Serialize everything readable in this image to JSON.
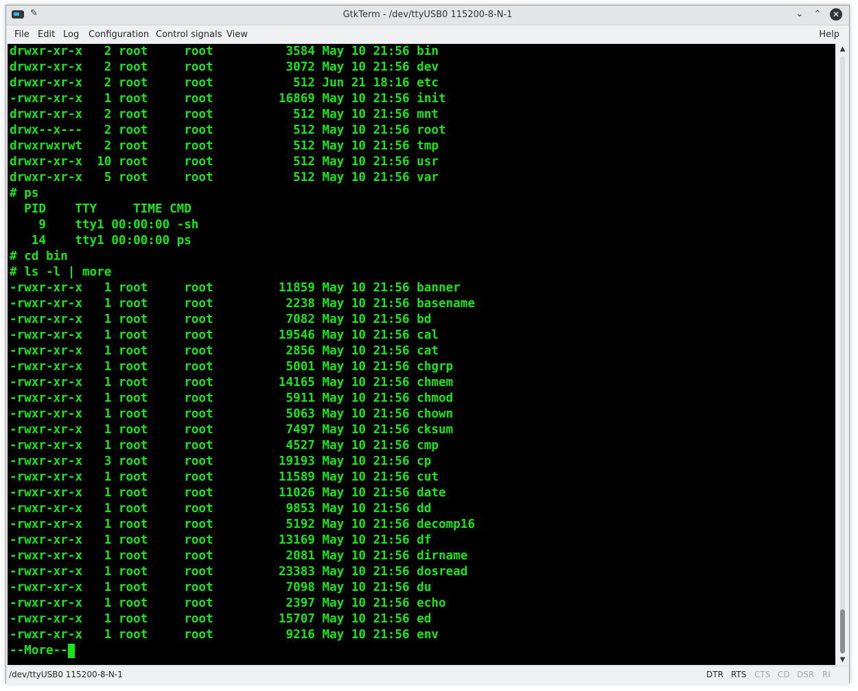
{
  "window": {
    "title": "GtkTerm - /dev/ttyUSB0 115200-8-N-1",
    "controls": {
      "minimize": "⌄",
      "maximize": "⌃",
      "close": "✕"
    },
    "icons": {
      "app": "terminal-app-icon",
      "pin": "pin-icon"
    }
  },
  "menubar": {
    "file": "File",
    "edit": "Edit",
    "log": "Log",
    "configuration": "Configuration",
    "control_signals": "Control signals",
    "view": "View",
    "help": "Help"
  },
  "terminal": {
    "text_color": "#19e619",
    "background": "#000000",
    "lines": [
      "drwxr-xr-x   2 root     root          3584 May 10 21:56 bin",
      "drwxr-xr-x   2 root     root          3072 May 10 21:56 dev",
      "drwxr-xr-x   2 root     root           512 Jun 21 18:16 etc",
      "-rwxr-xr-x   1 root     root         16869 May 10 21:56 init",
      "drwxr-xr-x   2 root     root           512 May 10 21:56 mnt",
      "drwx--x---   2 root     root           512 May 10 21:56 root",
      "drwxrwxrwt   2 root     root           512 May 10 21:56 tmp",
      "drwxr-xr-x  10 root     root           512 May 10 21:56 usr",
      "drwxr-xr-x   5 root     root           512 May 10 21:56 var",
      "# ps",
      "  PID    TTY     TIME CMD",
      "    9    tty1 00:00:00 -sh",
      "   14    tty1 00:00:00 ps",
      "# cd bin",
      "# ls -l | more",
      "-rwxr-xr-x   1 root     root         11859 May 10 21:56 banner",
      "-rwxr-xr-x   1 root     root          2238 May 10 21:56 basename",
      "-rwxr-xr-x   1 root     root          7082 May 10 21:56 bd",
      "-rwxr-xr-x   1 root     root         19546 May 10 21:56 cal",
      "-rwxr-xr-x   1 root     root          2856 May 10 21:56 cat",
      "-rwxr-xr-x   1 root     root          5001 May 10 21:56 chgrp",
      "-rwxr-xr-x   1 root     root         14165 May 10 21:56 chmem",
      "-rwxr-xr-x   1 root     root          5911 May 10 21:56 chmod",
      "-rwxr-xr-x   1 root     root          5063 May 10 21:56 chown",
      "-rwxr-xr-x   1 root     root          7497 May 10 21:56 cksum",
      "-rwxr-xr-x   1 root     root          4527 May 10 21:56 cmp",
      "-rwxr-xr-x   3 root     root         19193 May 10 21:56 cp",
      "-rwxr-xr-x   1 root     root         11589 May 10 21:56 cut",
      "-rwxr-xr-x   1 root     root         11026 May 10 21:56 date",
      "-rwxr-xr-x   1 root     root          9853 May 10 21:56 dd",
      "-rwxr-xr-x   1 root     root          5192 May 10 21:56 decomp16",
      "-rwxr-xr-x   1 root     root         13169 May 10 21:56 df",
      "-rwxr-xr-x   1 root     root          2081 May 10 21:56 dirname",
      "-rwxr-xr-x   1 root     root         23383 May 10 21:56 dosread",
      "-rwxr-xr-x   1 root     root          7098 May 10 21:56 du",
      "-rwxr-xr-x   1 root     root          2397 May 10 21:56 echo",
      "-rwxr-xr-x   1 root     root         15707 May 10 21:56 ed",
      "-rwxr-xr-x   1 root     root          9216 May 10 21:56 env"
    ],
    "prompt_line": "--More--"
  },
  "scrollbar": {
    "position_fraction": 0.95
  },
  "statusbar": {
    "port": "/dev/ttyUSB0  115200-8-N-1",
    "signals": [
      {
        "label": "DTR",
        "active": true
      },
      {
        "label": "RTS",
        "active": true
      },
      {
        "label": "CTS",
        "active": false
      },
      {
        "label": "CD",
        "active": false
      },
      {
        "label": "DSR",
        "active": false
      },
      {
        "label": "RI",
        "active": false
      }
    ]
  }
}
